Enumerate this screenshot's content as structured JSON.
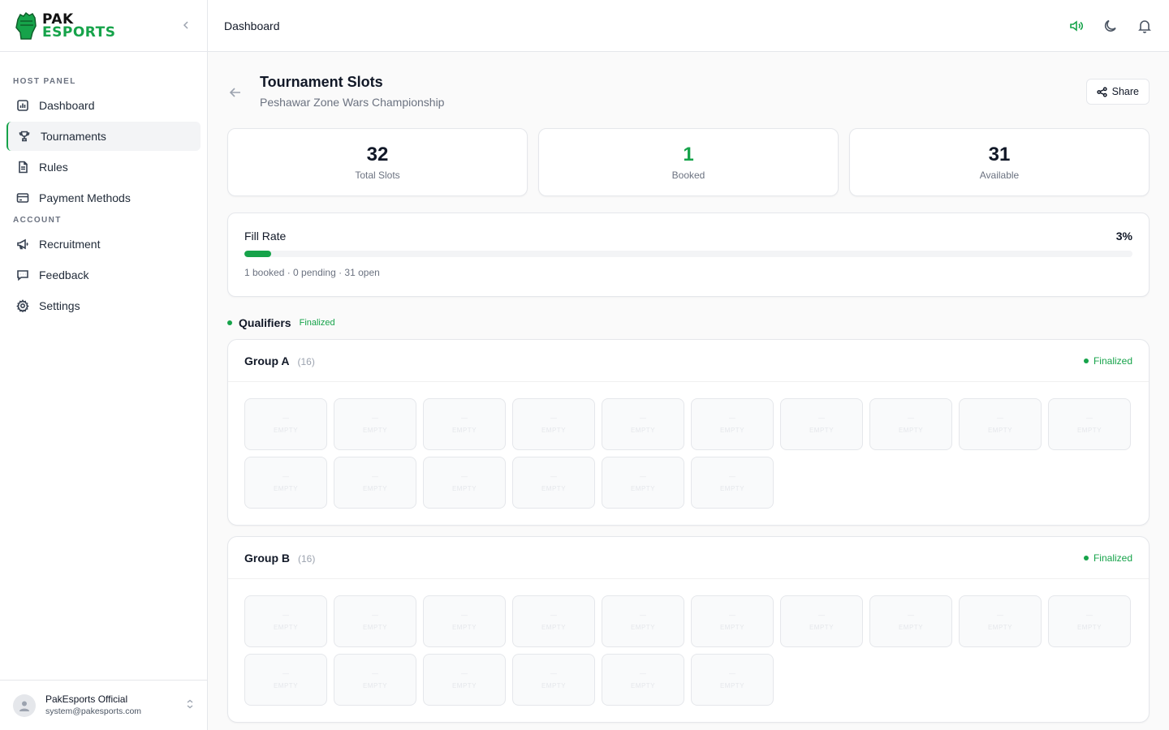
{
  "brand": {
    "line1": "PAK",
    "line2": "ESPORTS"
  },
  "sidebar": {
    "sections": [
      {
        "label": "HOST PANEL",
        "items": [
          {
            "label": "Dashboard",
            "icon": "chart-icon",
            "active": false
          },
          {
            "label": "Tournaments",
            "icon": "trophy-icon",
            "active": true
          },
          {
            "label": "Rules",
            "icon": "document-icon",
            "active": false
          },
          {
            "label": "Payment Methods",
            "icon": "credit-card-icon",
            "active": false
          }
        ]
      },
      {
        "label": "ACCOUNT",
        "items": [
          {
            "label": "Recruitment",
            "icon": "megaphone-icon",
            "active": false
          },
          {
            "label": "Feedback",
            "icon": "chat-icon",
            "active": false
          },
          {
            "label": "Settings",
            "icon": "gear-icon",
            "active": false
          }
        ]
      }
    ],
    "user": {
      "name": "PakEsports Official",
      "email": "system@pakesports.com"
    }
  },
  "topbar": {
    "title": "Dashboard"
  },
  "page": {
    "title": "Tournament Slots",
    "subtitle": "Peshawar Zone Wars Championship",
    "share_label": "Share"
  },
  "stats": [
    {
      "value": "32",
      "label": "Total Slots",
      "accent": false
    },
    {
      "value": "1",
      "label": "Booked",
      "accent": true
    },
    {
      "value": "31",
      "label": "Available",
      "accent": false
    }
  ],
  "fill": {
    "label": "Fill Rate",
    "percent_text": "3%",
    "percent": 3,
    "meta": "1 booked · 0 pending · 31 open"
  },
  "stage": {
    "name": "Qualifiers",
    "tag": "Finalized"
  },
  "groups": [
    {
      "name": "Group A",
      "count": "(16)",
      "status": "Finalized",
      "slots": 16,
      "slot_mark": "—",
      "slot_label": "EMPTY"
    },
    {
      "name": "Group B",
      "count": "(16)",
      "status": "Finalized",
      "slots": 16,
      "slot_mark": "—",
      "slot_label": "EMPTY"
    }
  ],
  "colors": {
    "accent": "#16a34a"
  }
}
